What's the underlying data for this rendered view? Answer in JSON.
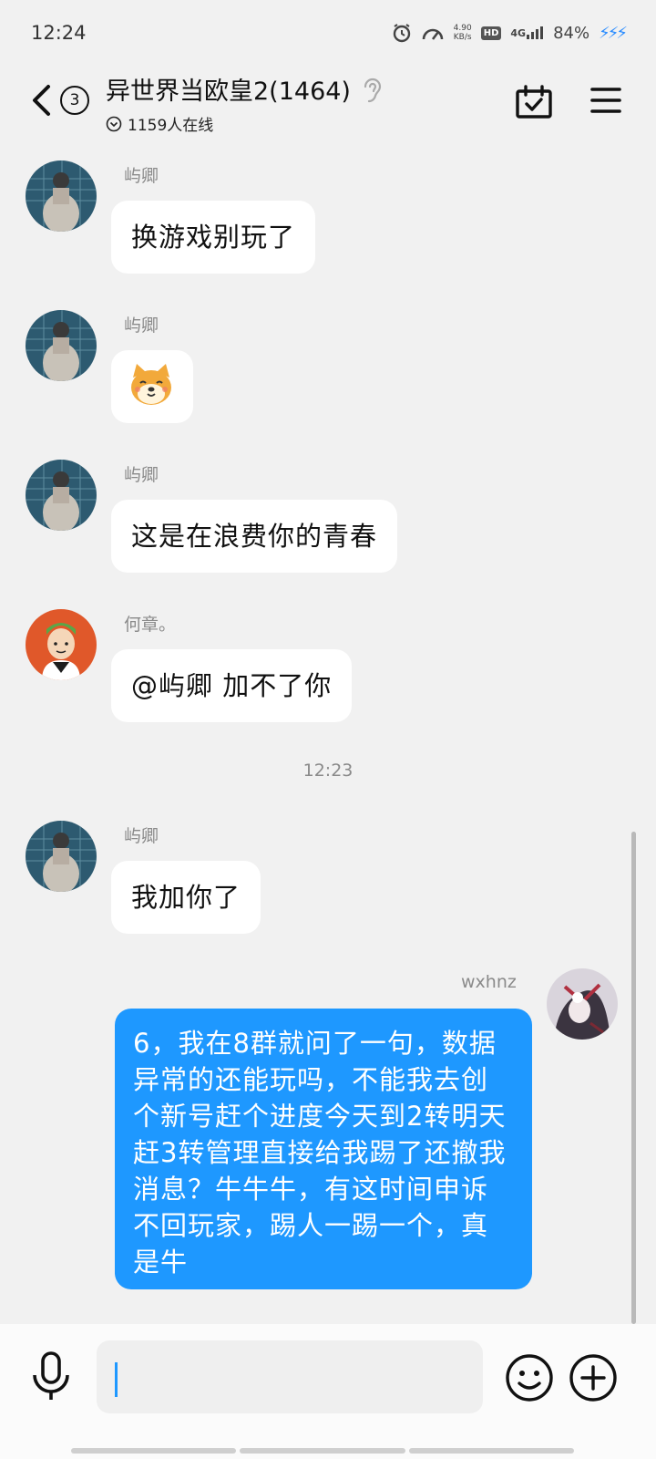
{
  "status_bar": {
    "time": "12:24",
    "net_speed_value": "4.90",
    "net_speed_unit": "KB/s",
    "hd_label": "HD",
    "signal_label": "4G",
    "battery": "84%"
  },
  "header": {
    "unread_count": "3",
    "title": "异世界当欧皇2(1464)",
    "online_text": "1159人在线"
  },
  "messages": [
    {
      "sender": "屿卿",
      "text": "换游戏别玩了",
      "avatar": "avatar-yuqing"
    },
    {
      "sender": "屿卿",
      "text": "",
      "sticker": "shiba-dog-sticker",
      "avatar": "avatar-yuqing"
    },
    {
      "sender": "屿卿",
      "text": "这是在浪费你的青春",
      "avatar": "avatar-yuqing"
    },
    {
      "sender": "何章。",
      "text": "@屿卿 加不了你",
      "avatar": "avatar-hezhang"
    },
    {
      "sender": "屿卿",
      "text": "我加你了",
      "avatar": "avatar-yuqing"
    },
    {
      "sender": "wxhnz",
      "text": "6，我在8群就问了一句，数据异常的还能玩吗，不能我去创个新号赶个进度今天到2转明天赶3转管理直接给我踢了还撤我消息？牛牛牛，有这时间申诉不回玩家，踢人一踢一个，真是牛",
      "avatar": "avatar-self",
      "self": true
    }
  ],
  "time_separator": "12:23",
  "input": {
    "value": "",
    "placeholder": ""
  },
  "colors": {
    "self_bubble": "#1e98ff",
    "background": "#f1f1f1",
    "bubble": "#ffffff"
  }
}
